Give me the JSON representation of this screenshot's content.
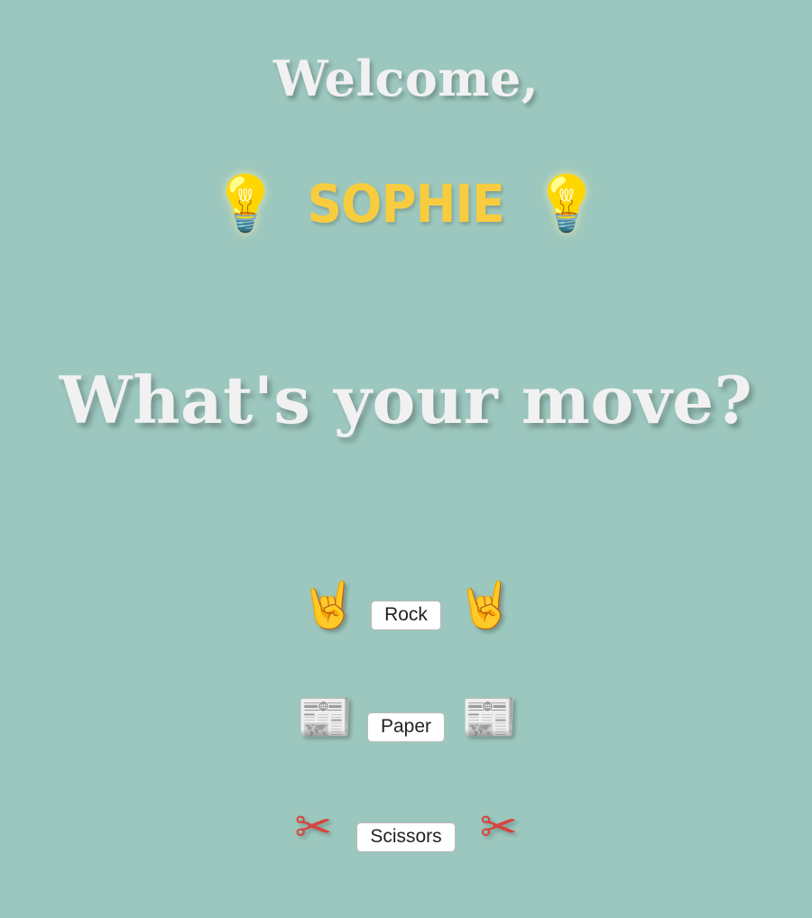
{
  "greeting": {
    "welcome_text": "Welcome,",
    "player_name": "SOPHIE",
    "name_icon": "lightbulb-icon"
  },
  "prompt": {
    "question": "What's your move?"
  },
  "moves": [
    {
      "label": "Rock",
      "icon": "rock-hand-icon"
    },
    {
      "label": "Paper",
      "icon": "newspaper-icon"
    },
    {
      "label": "Scissors",
      "icon": "scissors-icon"
    }
  ],
  "colors": {
    "background": "#9cc7be",
    "heading_text": "#f1f1f1",
    "name_accent": "#f7cd3f",
    "button_background": "#ffffff"
  }
}
